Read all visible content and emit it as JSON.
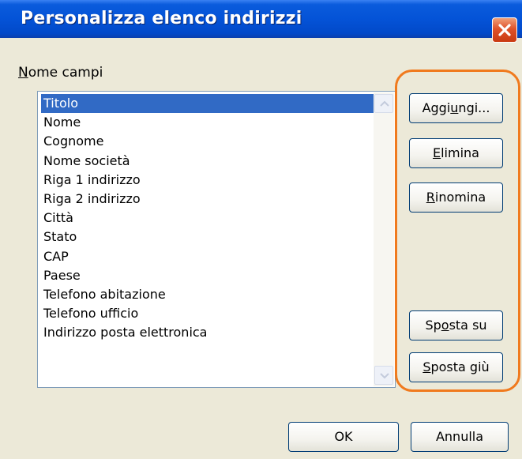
{
  "window": {
    "title": "Personalizza elenco indirizzi"
  },
  "field_label": {
    "mnemonic": "N",
    "rest": "ome campi"
  },
  "list": {
    "items": [
      "Titolo",
      "Nome",
      "Cognome",
      "Nome società",
      "Riga 1 indirizzo",
      "Riga 2 indirizzo",
      "Città",
      "Stato",
      "CAP",
      "Paese",
      "Telefono abitazione",
      "Telefono ufficio",
      "Indirizzo posta elettronica"
    ],
    "selected_index": 0
  },
  "buttons": {
    "aggiungi": {
      "pre": "Aggi",
      "mn": "u",
      "post": "ngi..."
    },
    "elimina": {
      "pre": "",
      "mn": "E",
      "post": "limina"
    },
    "rinomina": {
      "pre": "",
      "mn": "R",
      "post": "inomina"
    },
    "sposta_su": {
      "pre": "Sp",
      "mn": "o",
      "post": "sta su"
    },
    "sposta_giu": {
      "pre": "",
      "mn": "S",
      "post": "posta giù"
    },
    "ok": "OK",
    "annulla": "Annulla"
  },
  "icons": {
    "close": "close-icon",
    "scroll_up": "chevron-up-icon",
    "scroll_down": "chevron-down-icon"
  },
  "colors": {
    "titlebar": "#0453d7",
    "selection": "#316ac5",
    "highlight": "#f07a1e",
    "dialog_bg": "#ece9d8"
  }
}
